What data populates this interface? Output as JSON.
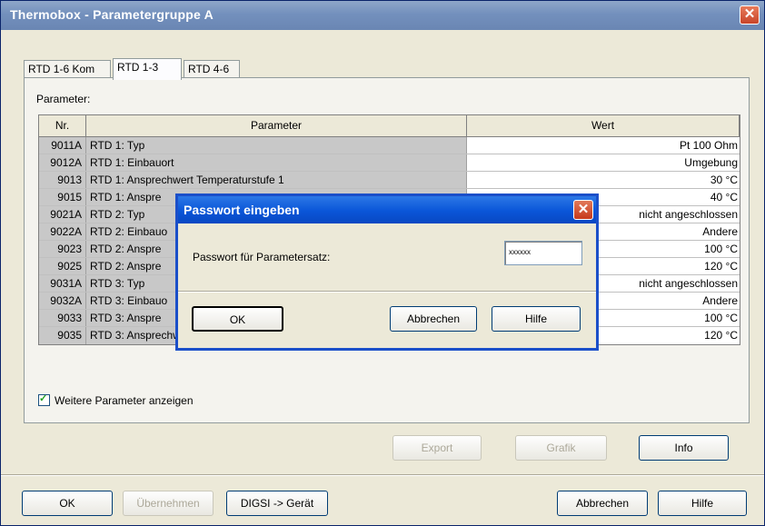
{
  "window": {
    "title": "Thermobox - Parametergruppe A",
    "close_label": "✕"
  },
  "tabs": [
    {
      "label": "RTD 1-6 Kom",
      "active": false
    },
    {
      "label": "RTD 1-3",
      "active": true
    },
    {
      "label": "RTD 4-6",
      "active": false
    }
  ],
  "parameters": {
    "label": "Parameter:",
    "columns": [
      "Nr.",
      "Parameter",
      "Wert"
    ],
    "rows": [
      {
        "nr": "9011A",
        "param": "RTD 1: Typ",
        "value": "Pt 100 Ohm"
      },
      {
        "nr": "9012A",
        "param": "RTD 1: Einbauort",
        "value": "Umgebung"
      },
      {
        "nr": "9013",
        "param": "RTD 1: Ansprechwert Temperaturstufe 1",
        "value": "30 °C"
      },
      {
        "nr": "9015",
        "param": "RTD 1: Anspre",
        "value": "40 °C"
      },
      {
        "nr": "9021A",
        "param": "RTD 2: Typ",
        "value": "nicht angeschlossen"
      },
      {
        "nr": "9022A",
        "param": "RTD 2: Einbauo",
        "value": "Andere"
      },
      {
        "nr": "9023",
        "param": "RTD 2: Anspre",
        "value": "100 °C"
      },
      {
        "nr": "9025",
        "param": "RTD 2: Anspre",
        "value": "120 °C"
      },
      {
        "nr": "9031A",
        "param": "RTD 3: Typ",
        "value": "nicht angeschlossen"
      },
      {
        "nr": "9032A",
        "param": "RTD 3: Einbauo",
        "value": "Andere"
      },
      {
        "nr": "9033",
        "param": "RTD 3: Anspre",
        "value": "100 °C"
      },
      {
        "nr": "9035",
        "param": "RTD 3: Ansprechwert Temperaturstufe 2",
        "value": "120 °C"
      }
    ],
    "show_more_checked": true,
    "show_more_label": "Weitere Parameter anzeigen"
  },
  "panel_buttons": {
    "export": "Export",
    "grafik": "Grafik",
    "info": "Info"
  },
  "footer_buttons": {
    "ok": "OK",
    "apply": "Übernehmen",
    "digsi": "DIGSI -> Gerät",
    "cancel": "Abbrechen",
    "help": "Hilfe"
  },
  "password_dialog": {
    "title": "Passwort eingeben",
    "close_label": "✕",
    "field_label": "Passwort für Parametersatz:",
    "value": "xxxxxx",
    "ok": "OK",
    "cancel": "Abbrechen",
    "help": "Hilfe"
  }
}
